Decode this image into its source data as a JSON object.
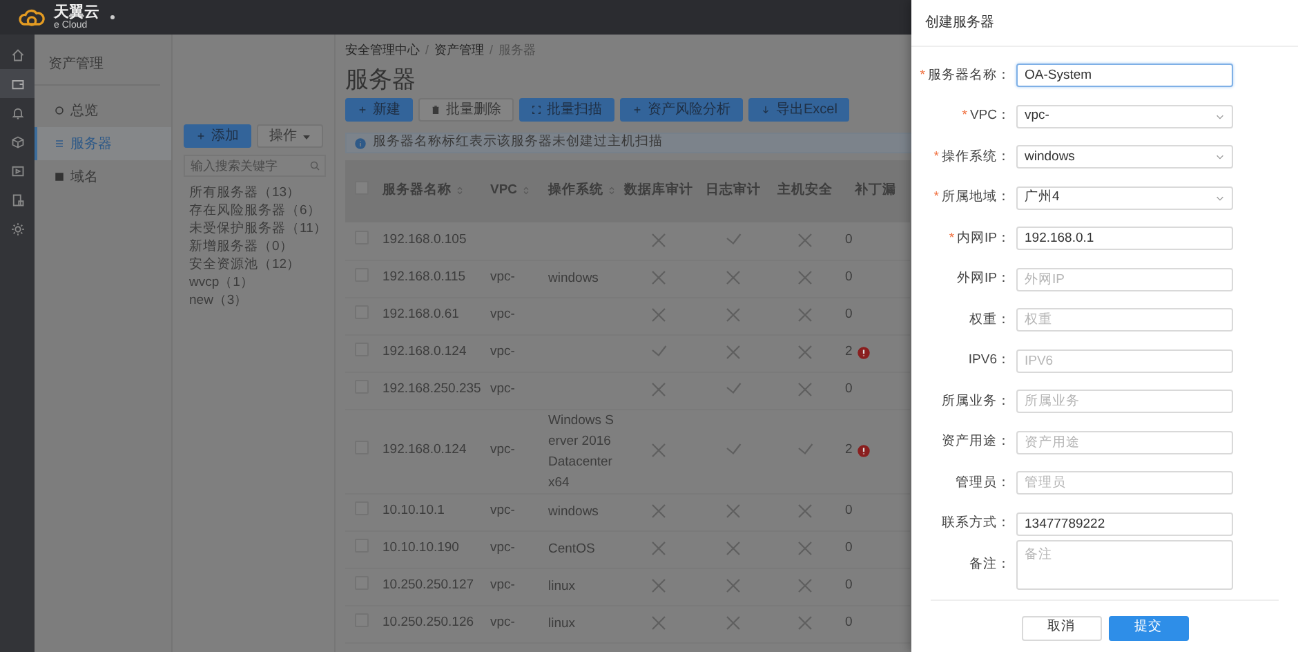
{
  "header": {
    "logo_text": "天翼云",
    "logo_sub": "e Cloud"
  },
  "rail": [
    {
      "selected": false
    },
    {
      "selected": true
    },
    {
      "selected": false
    },
    {
      "selected": false
    },
    {
      "selected": false
    },
    {
      "selected": false
    },
    {
      "selected": false
    }
  ],
  "sidebar": {
    "title": "资产管理",
    "items": [
      {
        "label": "总览",
        "selected": false
      },
      {
        "label": "服务器",
        "selected": true
      },
      {
        "label": "域名",
        "selected": false
      }
    ]
  },
  "groups": {
    "buttons": [
      {
        "label": "添加",
        "kind": "primary"
      },
      {
        "label": "操作",
        "kind": "dropdown"
      }
    ],
    "search": {
      "placeholder": "输入搜索关键字"
    },
    "items": [
      "所有服务器（13）",
      "存在风险服务器（6）",
      "未受保护服务器（11）",
      "新增服务器（0）",
      "安全资源池（12）",
      "wvcp（1）",
      "new（3）"
    ]
  },
  "breadcrumb": [
    {
      "text": "安全管理中心",
      "kind": "link"
    },
    {
      "text": "/",
      "kind": "separator"
    },
    {
      "text": "资产管理",
      "kind": "link"
    },
    {
      "text": "/",
      "kind": "separator"
    },
    {
      "text": "服务器",
      "kind": "current"
    }
  ],
  "page_title": "服务器",
  "toolbar": [
    {
      "label": "新建",
      "kind": "primary"
    },
    {
      "label": "批量删除",
      "kind": "default"
    },
    {
      "label": "批量扫描",
      "kind": "primary"
    },
    {
      "label": "资产风险分析",
      "kind": "primary"
    },
    {
      "label": "导出Excel",
      "kind": "primary"
    }
  ],
  "notice": "服务器名称标红表示该服务器未创建过主机扫描",
  "table": {
    "select_all": {
      "checked": false
    },
    "columns": [
      {
        "label": "服务器名称",
        "sortable": true
      },
      {
        "label": "VPC",
        "sortable": true
      },
      {
        "label": "操作系统",
        "sortable": true
      },
      {
        "label": "数据库审计",
        "sortable": false
      },
      {
        "label": "日志审计",
        "sortable": false
      },
      {
        "label": "主机安全",
        "sortable": false
      },
      {
        "label": "补丁漏",
        "sortable": false
      }
    ],
    "rows": [
      {
        "checked": false,
        "name": "192.168.0.105",
        "vpc": "",
        "os": "",
        "db_audit": false,
        "log_audit": true,
        "host_security": false,
        "patches": "0",
        "alert": false
      },
      {
        "checked": false,
        "name": "192.168.0.115",
        "vpc": "vpc-",
        "os": "windows",
        "db_audit": false,
        "log_audit": false,
        "host_security": false,
        "patches": "0",
        "alert": false
      },
      {
        "checked": false,
        "name": "192.168.0.61",
        "vpc": "vpc-",
        "os": "",
        "db_audit": false,
        "log_audit": false,
        "host_security": false,
        "patches": "0",
        "alert": false
      },
      {
        "checked": false,
        "name": "192.168.0.124",
        "vpc": "vpc-",
        "os": "",
        "db_audit": true,
        "log_audit": false,
        "host_security": false,
        "patches": "2",
        "alert": true
      },
      {
        "checked": false,
        "name": "192.168.250.235",
        "vpc": "vpc-",
        "os": "",
        "db_audit": false,
        "log_audit": true,
        "host_security": false,
        "patches": "0",
        "alert": false
      },
      {
        "checked": false,
        "name": "192.168.0.124",
        "vpc": "vpc-",
        "os": "Windows Server 2016 Datacenter x64",
        "db_audit": false,
        "log_audit": true,
        "host_security": true,
        "patches": "2",
        "alert": true
      },
      {
        "checked": false,
        "name": "10.10.10.1",
        "vpc": "vpc-",
        "os": "windows",
        "db_audit": false,
        "log_audit": false,
        "host_security": false,
        "patches": "0",
        "alert": false
      },
      {
        "checked": false,
        "name": "10.10.10.190",
        "vpc": "vpc-",
        "os": "CentOS",
        "db_audit": false,
        "log_audit": false,
        "host_security": false,
        "patches": "0",
        "alert": false
      },
      {
        "checked": false,
        "name": "10.250.250.127",
        "vpc": "vpc-",
        "os": "linux",
        "db_audit": false,
        "log_audit": false,
        "host_security": false,
        "patches": "0",
        "alert": false
      },
      {
        "checked": false,
        "name": "10.250.250.126",
        "vpc": "vpc-",
        "os": "linux",
        "db_audit": false,
        "log_audit": false,
        "host_security": false,
        "patches": "0",
        "alert": false
      }
    ]
  },
  "drawer": {
    "title": "创建服务器",
    "fields": [
      {
        "required_mark": "*",
        "label": "服务器名称：",
        "kind": "input",
        "value": "OA-System",
        "focused": true
      },
      {
        "required_mark": "*",
        "label": "VPC：",
        "kind": "select",
        "value": "vpc-",
        "focused": false
      },
      {
        "required_mark": "*",
        "label": "操作系统：",
        "kind": "select",
        "value": "windows",
        "focused": false
      },
      {
        "required_mark": "*",
        "label": "所属地域：",
        "kind": "select",
        "value": "广州4",
        "focused": false
      },
      {
        "required_mark": "*",
        "label": "内网IP：",
        "kind": "input",
        "value": "192.168.0.1",
        "focused": false
      },
      {
        "label": "外网IP：",
        "kind": "input",
        "placeholder": "外网IP",
        "focused": false
      },
      {
        "label": "权重：",
        "kind": "input",
        "placeholder": "权重",
        "focused": false
      },
      {
        "label": "IPV6：",
        "kind": "input",
        "placeholder": "IPV6",
        "focused": false
      },
      {
        "label": "所属业务：",
        "kind": "input",
        "placeholder": "所属业务",
        "focused": false
      },
      {
        "label": "资产用途：",
        "kind": "input",
        "placeholder": "资产用途",
        "focused": false
      },
      {
        "label": "管理员：",
        "kind": "input",
        "placeholder": "管理员",
        "focused": false
      },
      {
        "label": "联系方式：",
        "kind": "input",
        "value": "13477789222",
        "focused": false
      },
      {
        "label": "备注：",
        "kind": "textarea",
        "placeholder": "备注",
        "focused": false
      }
    ],
    "buttons": [
      {
        "label": "取消",
        "kind": "default"
      },
      {
        "label": "提交",
        "kind": "primary"
      }
    ]
  }
}
